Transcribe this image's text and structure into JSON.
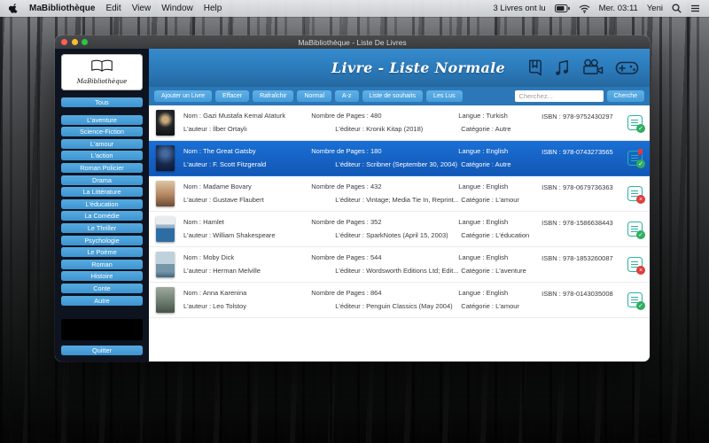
{
  "colors": {
    "accent_blue": "#4aa3dc",
    "header_blue": "#2a78b7",
    "selected_row_blue": "#1565c8",
    "sidebar_bg": "#0d1420",
    "status_teal": "#29b3a1",
    "status_green": "#2fae5f",
    "status_red": "#e03c3c"
  },
  "menu_bar": {
    "app_name": "MaBibliothèque",
    "menus": [
      "Edit",
      "View",
      "Window",
      "Help"
    ],
    "status_text": "3 Livres ont lu",
    "clock": "Mer. 03:11",
    "user": "Yeni",
    "icons": [
      "apple-icon",
      "battery-icon",
      "wifi-icon",
      "spotlight-icon",
      "notification-center-icon"
    ]
  },
  "window": {
    "title": "MaBibliothèque - Liste De Livres"
  },
  "sidebar": {
    "logo_text": "MaBibliothèque",
    "items": [
      "Tous",
      "L'aventure",
      "Science-Fiction",
      "L'amour",
      "L'action",
      "Roman Policier",
      "Drama",
      "La Littérature",
      "L'éducation",
      "La Comédie",
      "Le Thriller",
      "Psychologie",
      "Le Poème",
      "Roman",
      "Histoire",
      "Conte",
      "Autre"
    ],
    "quit": "Quitter"
  },
  "header": {
    "title": "Livre - Liste Normale",
    "icons": [
      "books-mode-icon",
      "music-mode-icon",
      "films-mode-icon",
      "games-mode-icon"
    ]
  },
  "toolbar": {
    "buttons": [
      "Ajouter un Livre",
      "Effacer",
      "Rafraîchir",
      "Normal",
      "A-z",
      "Liste de souhaits",
      "Les Lus"
    ],
    "search_placeholder": "Cherchez...",
    "search_button": "Cherche"
  },
  "labels": {
    "nom": "Nom :",
    "auteur": "L'auteur :",
    "pages": "Nombre de Pages :",
    "editeur": "L'éditeur :",
    "langue": "Langue :",
    "categorie": "Catégorie :",
    "isbn": "ISBN :"
  },
  "books": [
    {
      "nom": "Gazi Mustafa Kemal Ataturk",
      "auteur": "İlber Ortaylı",
      "pages": "480",
      "editeur": "Kronik Kitap (2018)",
      "langue": "Turkish",
      "categorie": "Autre",
      "isbn": "978-9752430297",
      "status": "read",
      "selected": false
    },
    {
      "nom": "The Great Gatsby",
      "auteur": "F. Scott Fitzgerald",
      "pages": "180",
      "editeur": "Scribner (September 30, 2004)",
      "langue": "English",
      "categorie": "Autre",
      "isbn": "978-0743273565",
      "status": "read-flagged",
      "selected": true
    },
    {
      "nom": "Madame Bovary",
      "auteur": "Gustave Flaubert",
      "pages": "432",
      "editeur": "Vintage; Media Tie In, Reprint...",
      "langue": "English",
      "categorie": "L'amour",
      "isbn": "978-0679736363",
      "status": "unread",
      "selected": false
    },
    {
      "nom": "Hamlet",
      "auteur": "William Shakespeare",
      "pages": "352",
      "editeur": "SparkNotes (April 15, 2003)",
      "langue": "English",
      "categorie": "L'éducation",
      "isbn": "978-1586638443",
      "status": "read",
      "selected": false
    },
    {
      "nom": "Moby Dick",
      "auteur": "Herman Melville",
      "pages": "544",
      "editeur": "Wordsworth Editions Ltd; Edit...",
      "langue": "English",
      "categorie": "L'aventure",
      "isbn": "978-1853260087",
      "status": "unread",
      "selected": false
    },
    {
      "nom": "Anna Karenina",
      "auteur": "Leo Tolstoy",
      "pages": "864",
      "editeur": "Penguin Classics (May 2004)",
      "langue": "English",
      "categorie": "L'amour",
      "isbn": "978-0143035008",
      "status": "read",
      "selected": false
    }
  ]
}
